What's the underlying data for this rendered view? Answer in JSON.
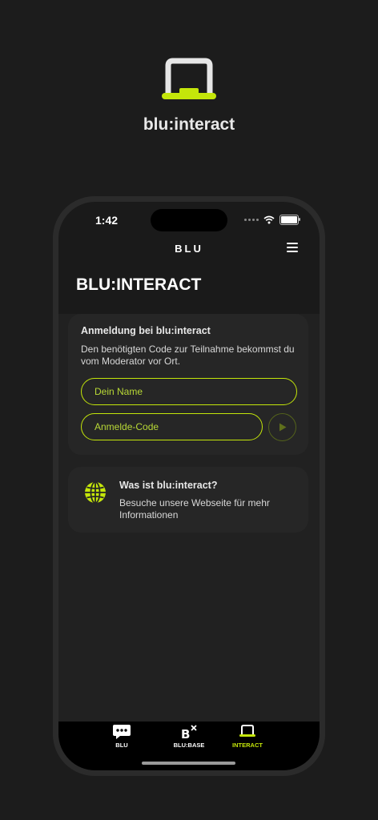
{
  "app": {
    "title": "blu:interact"
  },
  "status_bar": {
    "time": "1:42"
  },
  "header": {
    "brand": "BLU"
  },
  "page": {
    "title": "BLU:INTERACT"
  },
  "login_card": {
    "title": "Anmeldung bei blu:interact",
    "description": "Den benötigten Code zur Teilnahme bekommst du vom Moderator vor Ort.",
    "name_placeholder": "Dein Name",
    "code_placeholder": "Anmelde-Code"
  },
  "info_card": {
    "title": "Was ist blu:interact?",
    "text": "Besuche unsere Webseite für mehr Informationen",
    "icon": "globe-icon"
  },
  "tabbar": {
    "tabs": [
      {
        "label": "BLU",
        "icon": "chat-bubble-icon",
        "active": false
      },
      {
        "label": "BLU:BASE",
        "icon": "blu-base-icon",
        "active": false
      },
      {
        "label": "INTERACT",
        "icon": "laptop-icon",
        "active": true
      }
    ]
  },
  "colors": {
    "accent": "#c4e60a",
    "background": "#1c1c1c",
    "card": "#262626",
    "tabbar": "#000000"
  }
}
